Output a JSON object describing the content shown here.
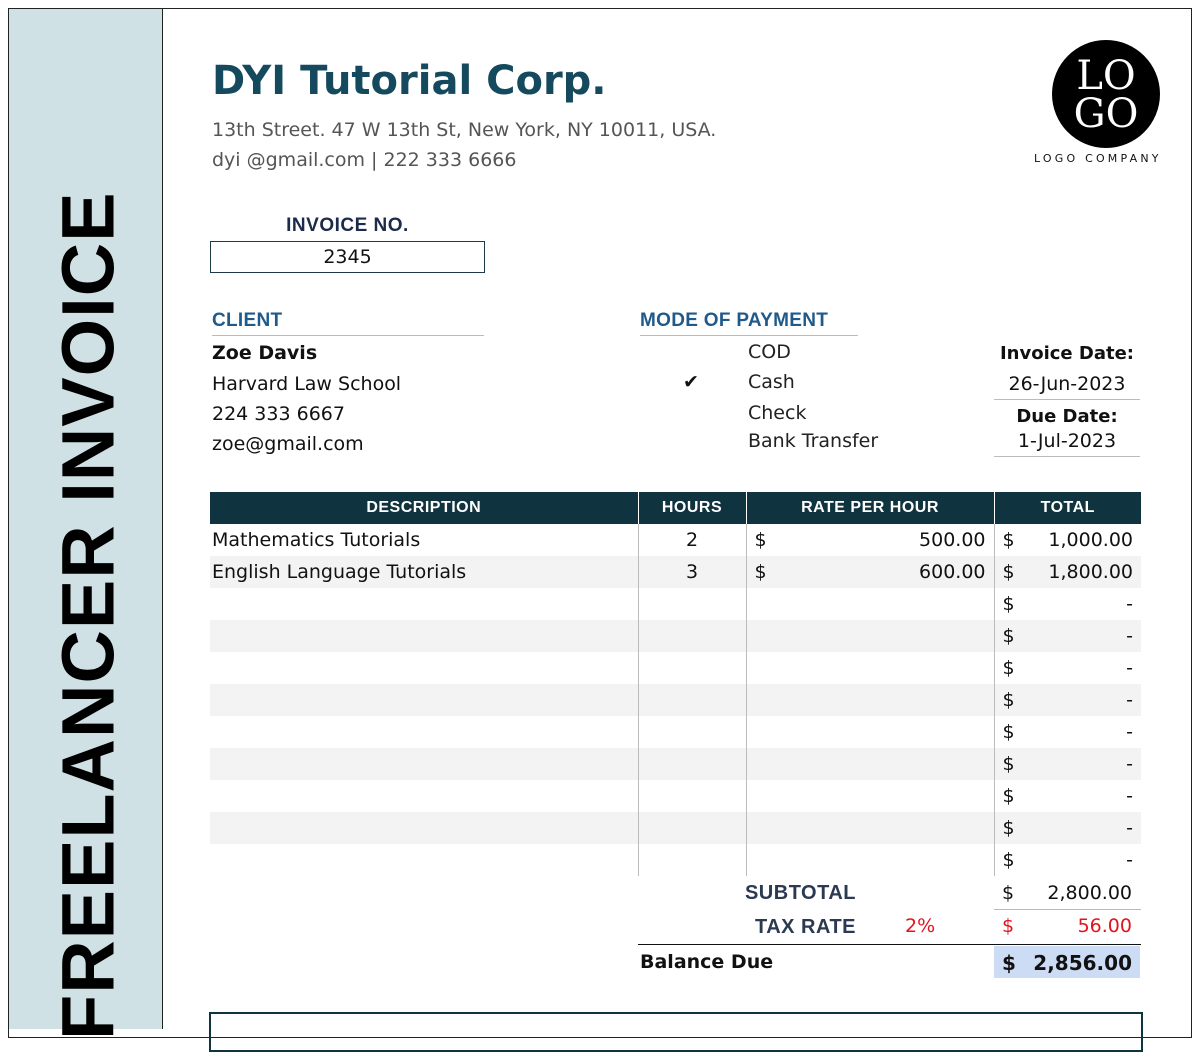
{
  "side_title": "FREELANCER INVOICE",
  "company": {
    "name": "DYI Tutorial Corp.",
    "address": "13th Street. 47 W 13th St, New York, NY 10011, USA.",
    "contact": "dyi @gmail.com | 222 333 6666"
  },
  "logo": {
    "line1": "LO",
    "line2": "GO",
    "caption": "LOGO COMPANY"
  },
  "invoice": {
    "label": "INVOICE NO.",
    "number": "2345"
  },
  "client": {
    "heading": "CLIENT",
    "name": "Zoe Davis",
    "school": "Harvard Law School",
    "phone": "224 333 6667",
    "email": "zoe@gmail.com"
  },
  "payment": {
    "heading": "MODE OF PAYMENT",
    "options": [
      "COD",
      "Cash",
      "Check",
      "Bank Transfer"
    ],
    "selected": "Cash",
    "check_mark": "✔"
  },
  "dates": {
    "invoice_label": "Invoice Date:",
    "invoice_value": "26-Jun-2023",
    "due_label": "Due Date:",
    "due_value": "1-Jul-2023"
  },
  "table": {
    "headers": [
      "DESCRIPTION",
      "HOURS",
      "RATE PER HOUR",
      "TOTAL"
    ],
    "currency": "$",
    "rows": [
      {
        "description": "Mathematics Tutorials",
        "hours": "2",
        "rate": "500.00",
        "total": "1,000.00"
      },
      {
        "description": "English Language Tutorials",
        "hours": "3",
        "rate": "600.00",
        "total": "1,800.00"
      },
      {
        "description": "",
        "hours": "",
        "rate": "",
        "total": "-"
      },
      {
        "description": "",
        "hours": "",
        "rate": "",
        "total": "-"
      },
      {
        "description": "",
        "hours": "",
        "rate": "",
        "total": "-"
      },
      {
        "description": "",
        "hours": "",
        "rate": "",
        "total": "-"
      },
      {
        "description": "",
        "hours": "",
        "rate": "",
        "total": "-"
      },
      {
        "description": "",
        "hours": "",
        "rate": "",
        "total": "-"
      },
      {
        "description": "",
        "hours": "",
        "rate": "",
        "total": "-"
      },
      {
        "description": "",
        "hours": "",
        "rate": "",
        "total": "-"
      },
      {
        "description": "",
        "hours": "",
        "rate": "",
        "total": "-"
      }
    ]
  },
  "summary": {
    "subtotal_label": "SUBTOTAL",
    "subtotal": "2,800.00",
    "tax_label": "TAX RATE",
    "tax_rate": "2%",
    "tax_amount": "56.00",
    "balance_label": "Balance Due",
    "balance": "2,856.00"
  },
  "colors": {
    "brand": "#154a5e",
    "side_band": "#d0e1e5",
    "table_header": "#10343f",
    "accent_blue": "#1f5a8a",
    "tax_red": "#e0141e",
    "balance_highlight": "#cddcf5"
  }
}
